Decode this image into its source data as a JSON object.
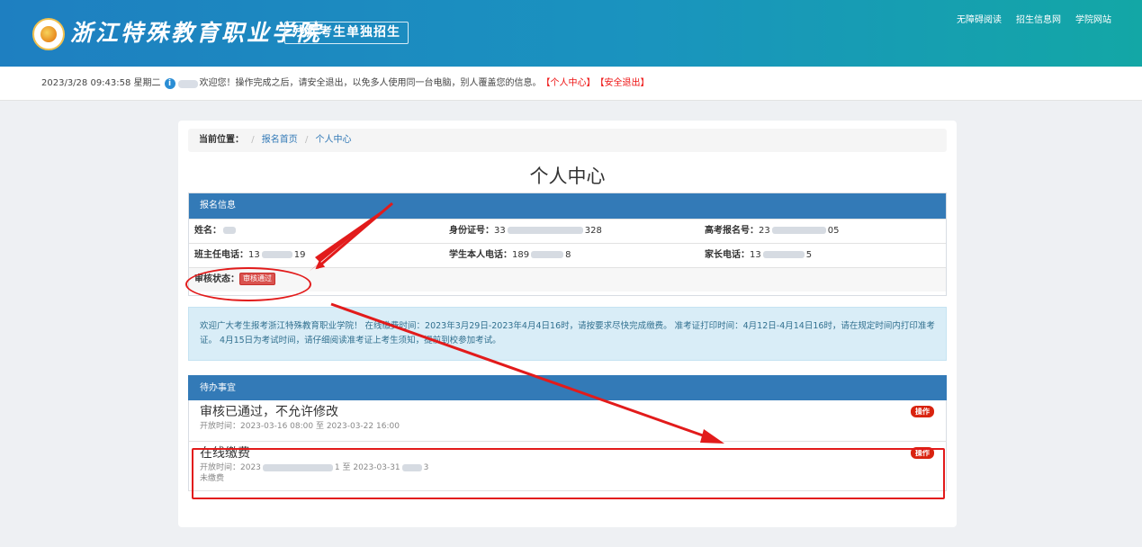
{
  "header": {
    "school_name": "浙江特殊教育职业学院",
    "sub_title": "残疾考生单独招生",
    "nav": [
      "无障碍阅读",
      "招生信息网",
      "学院网站"
    ]
  },
  "infobar": {
    "datetime": "2023/3/28 09:43:58 星期二",
    "welcome": "欢迎您！操作完成之后，请安全退出，以免多人使用同一台电脑，别人覆盖您的信息。",
    "link_center": "【个人中心】",
    "link_logout": "【安全退出】"
  },
  "breadcrumb": {
    "label": "当前位置：",
    "sep": "/",
    "items": [
      "报名首页",
      "个人中心"
    ]
  },
  "page_title": "个人中心",
  "registration": {
    "heading": "报名信息",
    "name_label": "姓名：",
    "id_label": "身份证号：",
    "id_prefix": "33",
    "id_suffix": "328",
    "exam_label": "高考报名号：",
    "exam_prefix": "23",
    "exam_suffix": "05",
    "teacher_label": "班主任电话：",
    "teacher_prefix": "13",
    "teacher_suffix": "19",
    "student_label": "学生本人电话：",
    "student_prefix": "189",
    "student_suffix": "8",
    "parent_label": "家长电话：",
    "parent_prefix": "13",
    "parent_suffix": "5",
    "status_label": "审核状态：",
    "status_value": "审核通过"
  },
  "notice": "欢迎广大考生报考浙江特殊教育职业学院！ 在线缴费时间：2023年3月29日-2023年4月4日16时，请按要求尽快完成缴费。 准考证打印时间：4月12日-4月14日16时，请在规定时间内打印准考证。 4月15日为考试时间，请仔细阅读准考证上考生须知，提前到校参加考试。",
  "todo": {
    "heading": "待办事宜",
    "items": [
      {
        "title": "审核已通过，不允许修改",
        "time": "开放时间：2023-03-16 08:00 至 2023-03-22 16:00",
        "action": "操作"
      },
      {
        "title": "在线缴费",
        "time_prefix": "开放时间：2023",
        "time_mid": "1 至 2023-03-31",
        "time_suffix": "3",
        "status": "未缴费",
        "action": "操作"
      }
    ]
  },
  "colors": {
    "header_start": "#1e7fc1",
    "header_end": "#13a7a6",
    "panel_blue": "#337ab7",
    "annotation_red": "#e21b1b"
  }
}
